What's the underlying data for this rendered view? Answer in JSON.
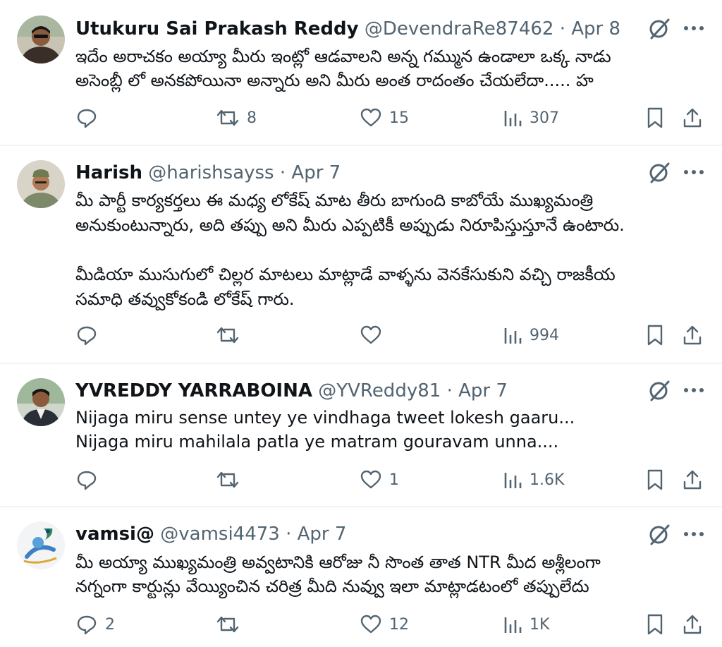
{
  "tweets": [
    {
      "name": "Utukuru Sai Prakash Reddy",
      "handle": "@DevendraRe87462",
      "separator": "·",
      "date": "Apr 8",
      "lines": [
        "ఇదేం అరాచకం అయ్యా మీరు ఇంట్లో ఆడవాలని అన్న గమ్మున ఉండాలా ఒక్క నాడు",
        "అసెంబ్లీ లో అనకపోయినా అన్నారు అని మీరు అంత రాదంతం చేయలేదా..... హ"
      ],
      "replies": "",
      "retweets": "8",
      "likes": "15",
      "views": "307"
    },
    {
      "name": "Harish",
      "handle": "@harishsayss",
      "separator": "·",
      "date": "Apr 7",
      "lines": [
        "మీ పార్టీ కార్యకర్తలు ఈ మధ్య లోకేష్ మాట తీరు బాగుంది కాబోయే ముఖ్యమంత్రి",
        "అనుకుంటున్నారు, అది తప్పు అని మీరు ఎప్పటికీ అప్పుడు నిరూపిస్తుస్తూనే ఉంటారు.",
        "",
        "మీడియా ముసుగులో చిల్లర మాటలు మాట్లాడే వాళ్ళను వెనకేసుకుని వచ్చి రాజకీయ",
        "సమాధి తవ్వుకోకండి లోకేష్ గారు."
      ],
      "replies": "",
      "retweets": "",
      "likes": "",
      "views": "994"
    },
    {
      "name": "YVREDDY YARRABOINA",
      "handle": "@YVReddy81",
      "separator": "·",
      "date": "Apr 7",
      "lines": [
        "Nijaga miru sense untey ye vindhaga tweet lokesh gaaru...",
        "Nijaga miru mahilala patla ye matram gouravam unna...."
      ],
      "replies": "",
      "retweets": "",
      "likes": "1",
      "views": "1.6K"
    },
    {
      "name": "vamsi@",
      "handle": "@vamsi4473",
      "separator": "·",
      "date": "Apr 7",
      "lines": [
        "మీ అయ్యా ముఖ్యమంత్రి అవ్వటానికి ఆరోజు నీ సొంత తాత  NTR మీద అశ్లీలంగా",
        "నగ్నంగా కార్టున్లు వేయ్యించిన చరిత్ర మీది నువ్వు ఇలా మాట్లాడటంలో తప్పులేదు"
      ],
      "replies": "2",
      "retweets": "",
      "likes": "12",
      "views": "1K"
    }
  ],
  "icons": {
    "reply": "reply-icon",
    "retweet": "retweet-icon",
    "like": "like-icon",
    "views": "views-icon",
    "bookmark": "bookmark-icon",
    "share": "share-icon",
    "grok": "grok-icon",
    "more": "more-icon"
  },
  "colors": {
    "text": "#0f1419",
    "muted": "#536471",
    "divider": "#eff3f4"
  }
}
